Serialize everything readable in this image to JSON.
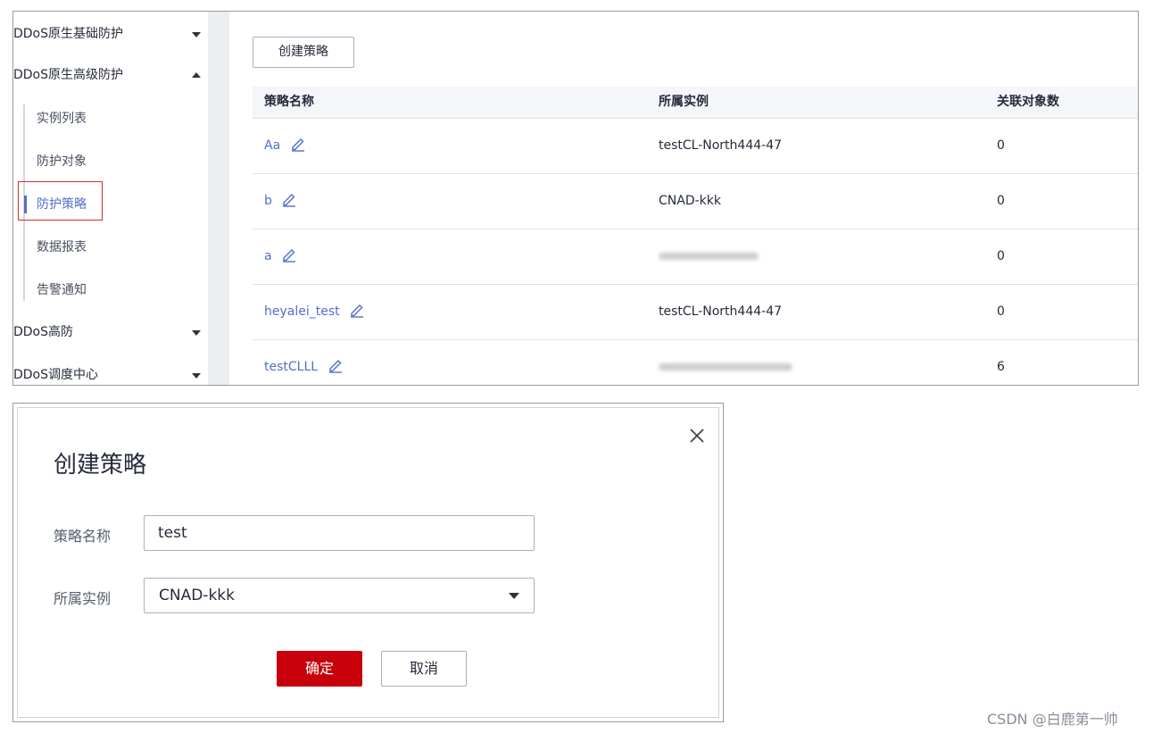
{
  "sidebar": {
    "groups": [
      {
        "label": "DDoS原生基础防护"
      },
      {
        "label": "DDoS原生高级防护"
      },
      {
        "label": "DDoS高防"
      },
      {
        "label": "DDoS调度中心"
      }
    ],
    "sub_items": [
      {
        "label": "实例列表"
      },
      {
        "label": "防护对象"
      },
      {
        "label": "防护策略",
        "active": true
      },
      {
        "label": "数据报表"
      },
      {
        "label": "告警通知"
      }
    ]
  },
  "main": {
    "create_label": "创建策略",
    "columns": [
      "策略名称",
      "所属实例",
      "关联对象数"
    ],
    "rows": [
      {
        "name": "Aa",
        "instance": "testCL-North444-47",
        "count": "0"
      },
      {
        "name": "b",
        "instance": "CNAD-kkk",
        "count": "0"
      },
      {
        "name": "a",
        "instance": "",
        "count": "0"
      },
      {
        "name": "heyalei_test",
        "instance": "testCL-North444-47",
        "count": "0"
      },
      {
        "name": "testCLLL",
        "instance": "",
        "count": "6"
      }
    ]
  },
  "dialog": {
    "title": "创建策略",
    "name_label": "策略名称",
    "name_value": "test",
    "instance_label": "所属实例",
    "instance_value": "CNAD-kkk",
    "ok_label": "确定",
    "cancel_label": "取消"
  },
  "watermark": "CSDN @白鹿第一帅",
  "colors": {
    "link": "#526ecc",
    "primary_button": "#c7000b",
    "highlight_box": "#d92b2b"
  }
}
